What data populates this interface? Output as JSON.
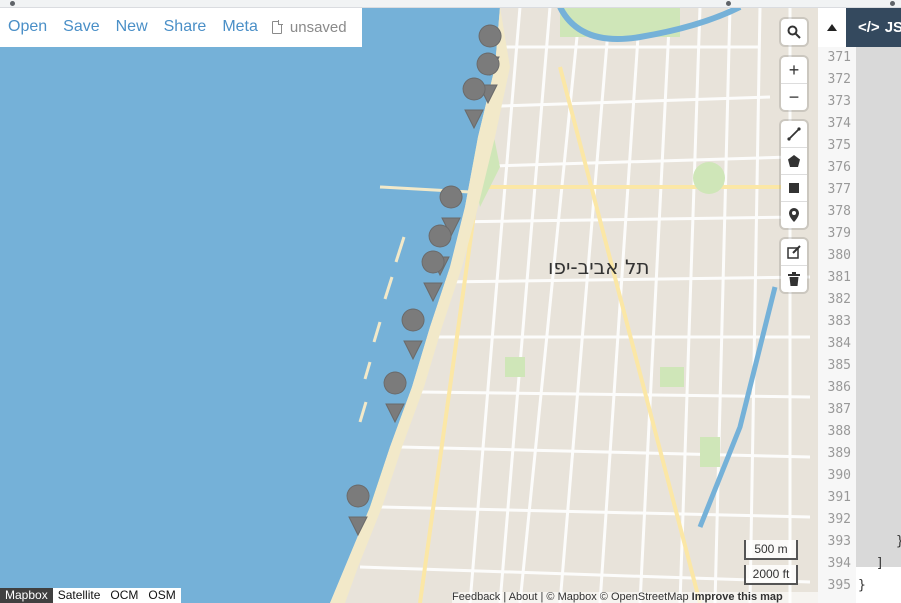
{
  "toolbar": {
    "open": "Open",
    "save": "Save",
    "new": "New",
    "share": "Share",
    "meta": "Meta",
    "status": "unsaved"
  },
  "map": {
    "city_label": "תל אביב-יפו",
    "marker_count": 9,
    "marker_color": "#7b7b7b",
    "water_color": "#75b1d8",
    "land_color": "#e8e3da"
  },
  "controls": {
    "search": "search-icon",
    "zoom_in": "+",
    "zoom_out": "−",
    "draw": [
      "line-icon",
      "polygon-icon",
      "rectangle-icon",
      "marker-icon"
    ],
    "edit": [
      "edit-icon",
      "trash-icon"
    ]
  },
  "scale": {
    "metric": "500 m",
    "imperial": "2000 ft"
  },
  "layers": [
    "Mapbox",
    "Satellite",
    "OCM",
    "OSM"
  ],
  "attribution": {
    "feedback": "Feedback",
    "about": "About",
    "mapbox": "© Mapbox",
    "osm": "© OpenStreetMap",
    "improve": "Improve this map"
  },
  "editor": {
    "tab_label": "JSON",
    "line_numbers": [
      "371",
      "372",
      "373",
      "374",
      "375",
      "376",
      "377",
      "378",
      "379",
      "380",
      "381",
      "382",
      "383",
      "384",
      "385",
      "386",
      "387",
      "388",
      "389",
      "390",
      "391",
      "392",
      "393",
      "394",
      "395"
    ],
    "line_393": "}",
    "line_394": "]",
    "line_395": "}"
  }
}
